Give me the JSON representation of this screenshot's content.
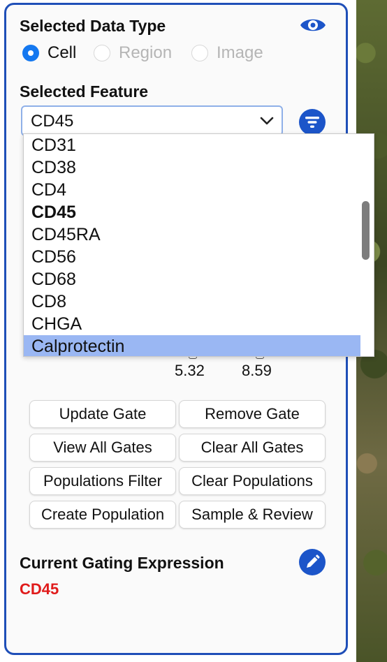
{
  "data_type": {
    "title": "Selected Data Type",
    "options": [
      {
        "label": "Cell",
        "selected": true,
        "enabled": true
      },
      {
        "label": "Region",
        "selected": false,
        "enabled": false
      },
      {
        "label": "Image",
        "selected": false,
        "enabled": false
      }
    ]
  },
  "feature": {
    "title": "Selected Feature",
    "selected_value": "CD45",
    "dropdown_options": [
      "CD31",
      "CD38",
      "CD4",
      "CD45",
      "CD45RA",
      "CD56",
      "CD68",
      "CD8",
      "CHGA",
      "Calprotectin"
    ],
    "highlighted_option": "Calprotectin"
  },
  "range": {
    "min": "5.32",
    "max": "8.59"
  },
  "buttons": {
    "update_gate": "Update Gate",
    "remove_gate": "Remove Gate",
    "view_all_gates": "View All Gates",
    "clear_all_gates": "Clear All Gates",
    "populations_filter": "Populations Filter",
    "clear_populations": "Clear Populations",
    "create_population": "Create Population",
    "sample_review": "Sample & Review"
  },
  "gating": {
    "title": "Current Gating Expression",
    "expression": "CD45"
  },
  "icons": {
    "visibility": "eye-icon",
    "filter": "filter-icon",
    "edit": "pencil-icon"
  },
  "colors": {
    "accent": "#1c55c9",
    "expression": "#e01b1b",
    "highlight": "#9ab7f3"
  }
}
